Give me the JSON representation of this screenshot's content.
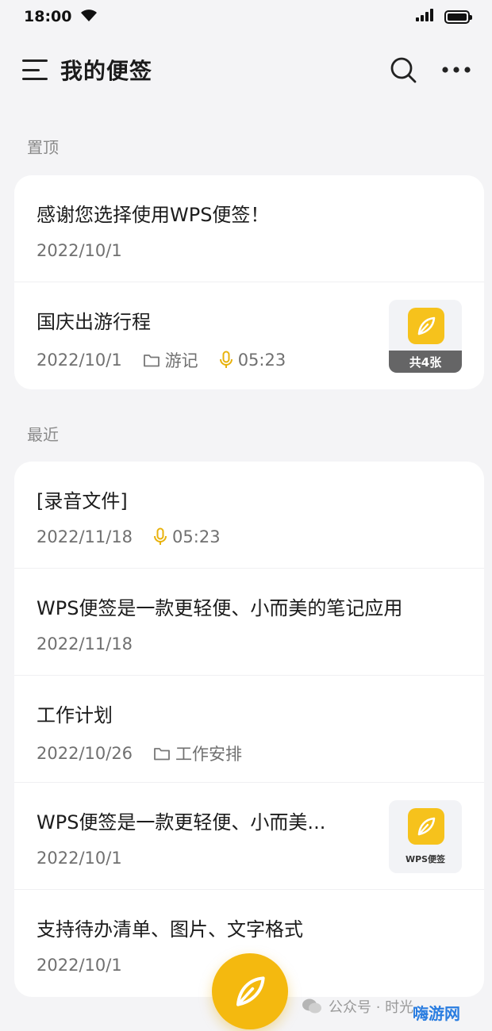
{
  "status_bar": {
    "time": "18:00"
  },
  "header": {
    "title": "我的便签"
  },
  "sections": {
    "pinned_label": "置顶",
    "recent_label": "最近"
  },
  "pinned": [
    {
      "title": "感谢您选择使用WPS便签！",
      "date": "2022/10/1"
    },
    {
      "title": "国庆出游行程",
      "date": "2022/10/1",
      "folder": "游记",
      "audio": "05:23",
      "thumb_count": "共4张"
    }
  ],
  "recent": [
    {
      "title": "[录音文件]",
      "date": "2022/11/18",
      "audio": "05:23"
    },
    {
      "title": "WPS便签是一款更轻便、小而美的笔记应用",
      "date": "2022/11/18"
    },
    {
      "title": "工作计划",
      "date": "2022/10/26",
      "folder": "工作安排"
    },
    {
      "title": "WPS便签是一款更轻便、小而美...",
      "date": "2022/10/1",
      "thumb_caption": "WPS便签"
    },
    {
      "title": "支持待办清单、图片、文字格式",
      "date": "2022/10/1"
    }
  ],
  "watermark": {
    "text": "公众号 · 时光",
    "site": "嗨游网"
  },
  "colors": {
    "accent": "#f4b90f",
    "audio_icon": "#e8b20c",
    "background": "#f4f4f6"
  },
  "icons": [
    "wifi-icon",
    "signal-icon",
    "battery-icon",
    "menu-icon",
    "search-icon",
    "more-icon",
    "folder-icon",
    "microphone-icon",
    "feather-icon",
    "wechat-icon"
  ]
}
